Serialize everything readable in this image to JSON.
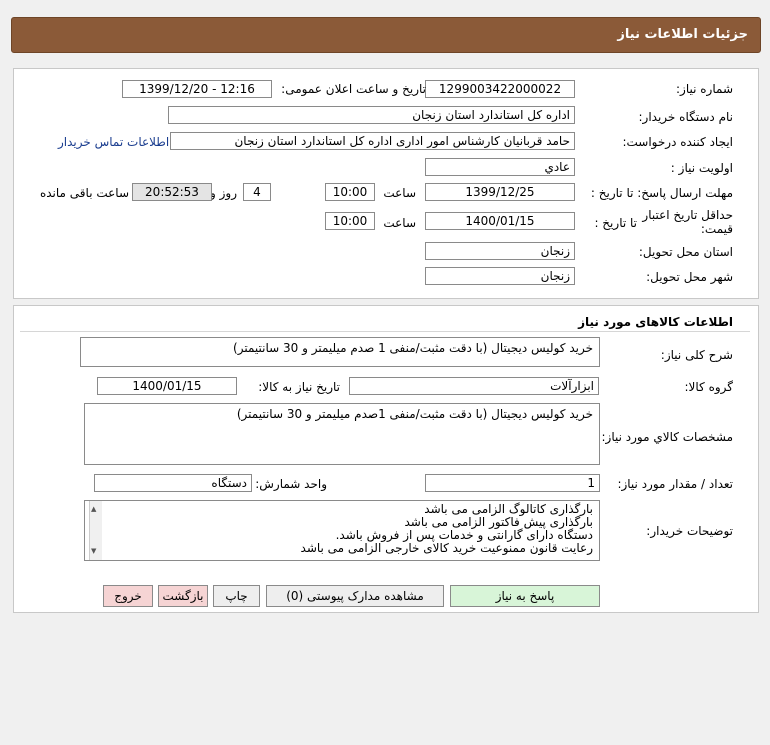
{
  "header": {
    "title": "جزئیات اطلاعات نیاز"
  },
  "need_info": {
    "need_number_label": "شماره نیاز:",
    "need_number": "1299003422000022",
    "announce_label": "تاریخ و ساعت اعلان عمومی:",
    "announce_value": "1399/12/20 - 12:16",
    "buyer_org_label": "نام دستگاه خریدار:",
    "buyer_org": "اداره کل استاندارد استان زنجان",
    "creator_label": "ایجاد کننده درخواست:",
    "creator": "حامد قربانیان کارشناس امور اداری اداره کل استاندارد استان زنجان",
    "contact_link": "اطلاعات تماس خریدار",
    "priority_label": "اولویت نیاز :",
    "priority": "عادي",
    "deadline_label": "مهلت ارسال پاسخ: تا تاریخ :",
    "deadline_date": "1399/12/25",
    "time_label": "ساعت",
    "deadline_time": "10:00",
    "days_value": "4",
    "days_label": "روز و",
    "remaining_time": "20:52:53",
    "remaining_label": "ساعت باقی مانده",
    "validity_label_1": "حداقل تاریخ اعتبار",
    "validity_label_2": "قیمت:",
    "validity_to_label": "تا تاریخ :",
    "validity_date": "1400/01/15",
    "validity_time_label": "ساعت",
    "validity_time": "10:00",
    "province_label": "استان محل تحویل:",
    "province": "زنجان",
    "city_label": "شهر محل تحویل:",
    "city": "زنجان"
  },
  "goods": {
    "section_title": "اطلاعات کالاهای مورد نیاز",
    "general_desc_label": "شرح کلی نیاز:",
    "general_desc": "خرید کولیس دیجیتال (با دقت مثبت/منفی 1 صدم میلیمتر و 30 سانتیمتر)",
    "group_label": "گروه کالا:",
    "group": "ابزارآلات",
    "need_date_label": "تاریخ نیاز به کالا:",
    "need_date": "1400/01/15",
    "specs_label": "مشخصات كالاي مورد نياز:",
    "specs": "خرید کولیس دیجیتال (با دقت مثبت/منفی 1صدم میلیمتر و 30 سانتیمتر)",
    "qty_label": "تعداد / مقدار مورد نیاز:",
    "qty": "1",
    "unit_label": "واحد شمارش:",
    "unit": "دستگاه",
    "notes_label": "توضیحات خریدار:",
    "notes": [
      "بارگذاری کاتالوگ الزامی می باشد",
      "بارگذاری پیش فاکتور الزامی می باشد",
      "دستگاه دارای گارانتی و خدمات پس از فروش باشد.",
      "رعایت قانون ممنوعیت خرید کالای خارجی الزامی می باشد"
    ]
  },
  "buttons": {
    "reply": "پاسخ به نیاز",
    "attachments": "مشاهده مدارک پیوستی (0)",
    "print": "چاپ",
    "back": "بازگشت",
    "exit": "خروج"
  }
}
